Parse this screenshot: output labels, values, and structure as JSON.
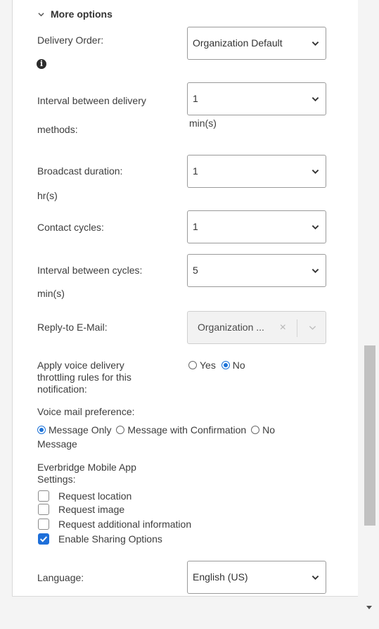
{
  "section": {
    "label": "More options"
  },
  "delivery_order": {
    "label": "Delivery Order:",
    "value": "Organization Default"
  },
  "interval_methods": {
    "label_line1": "Interval between delivery",
    "label_line2": "methods:",
    "value": "1",
    "unit": "min(s)"
  },
  "broadcast_duration": {
    "label": "Broadcast duration:",
    "value": "1",
    "unit": "hr(s)"
  },
  "contact_cycles": {
    "label": "Contact cycles:",
    "value": "1"
  },
  "interval_cycles": {
    "label": "Interval between cycles:",
    "value": "5",
    "unit": "min(s)"
  },
  "reply_to": {
    "label": "Reply-to E-Mail:",
    "value": "Organization ...",
    "clear": "×"
  },
  "voice_throttling": {
    "label_line1": "Apply voice delivery",
    "label_line2": "throttling rules for this",
    "label_line3": "notification:",
    "options": [
      {
        "label": "Yes",
        "selected": false
      },
      {
        "label": "No",
        "selected": true
      }
    ]
  },
  "voice_mail": {
    "label": "Voice mail preference:",
    "options": [
      {
        "label": "Message Only",
        "selected": true
      },
      {
        "label": "Message with Confirmation",
        "selected": false
      },
      {
        "label": "No",
        "selected": false
      }
    ],
    "wrap_text": "Message"
  },
  "mobile_app": {
    "label_line1": "Everbridge Mobile App",
    "label_line2": "Settings:",
    "checkboxes": [
      {
        "label": "Request location",
        "checked": false
      },
      {
        "label": "Request image",
        "checked": false
      },
      {
        "label": "Request additional information",
        "checked": false
      },
      {
        "label": "Enable Sharing Options",
        "checked": true
      }
    ]
  },
  "language": {
    "label": "Language:",
    "value": "English (US)"
  },
  "colors": {
    "accent": "#1e73d8",
    "border": "#9a9a9a",
    "scroll_thumb": "#c1c1c1"
  },
  "icons": [
    "chevron-down-icon",
    "info-icon",
    "caret-down-icon",
    "close-icon",
    "check-icon"
  ]
}
